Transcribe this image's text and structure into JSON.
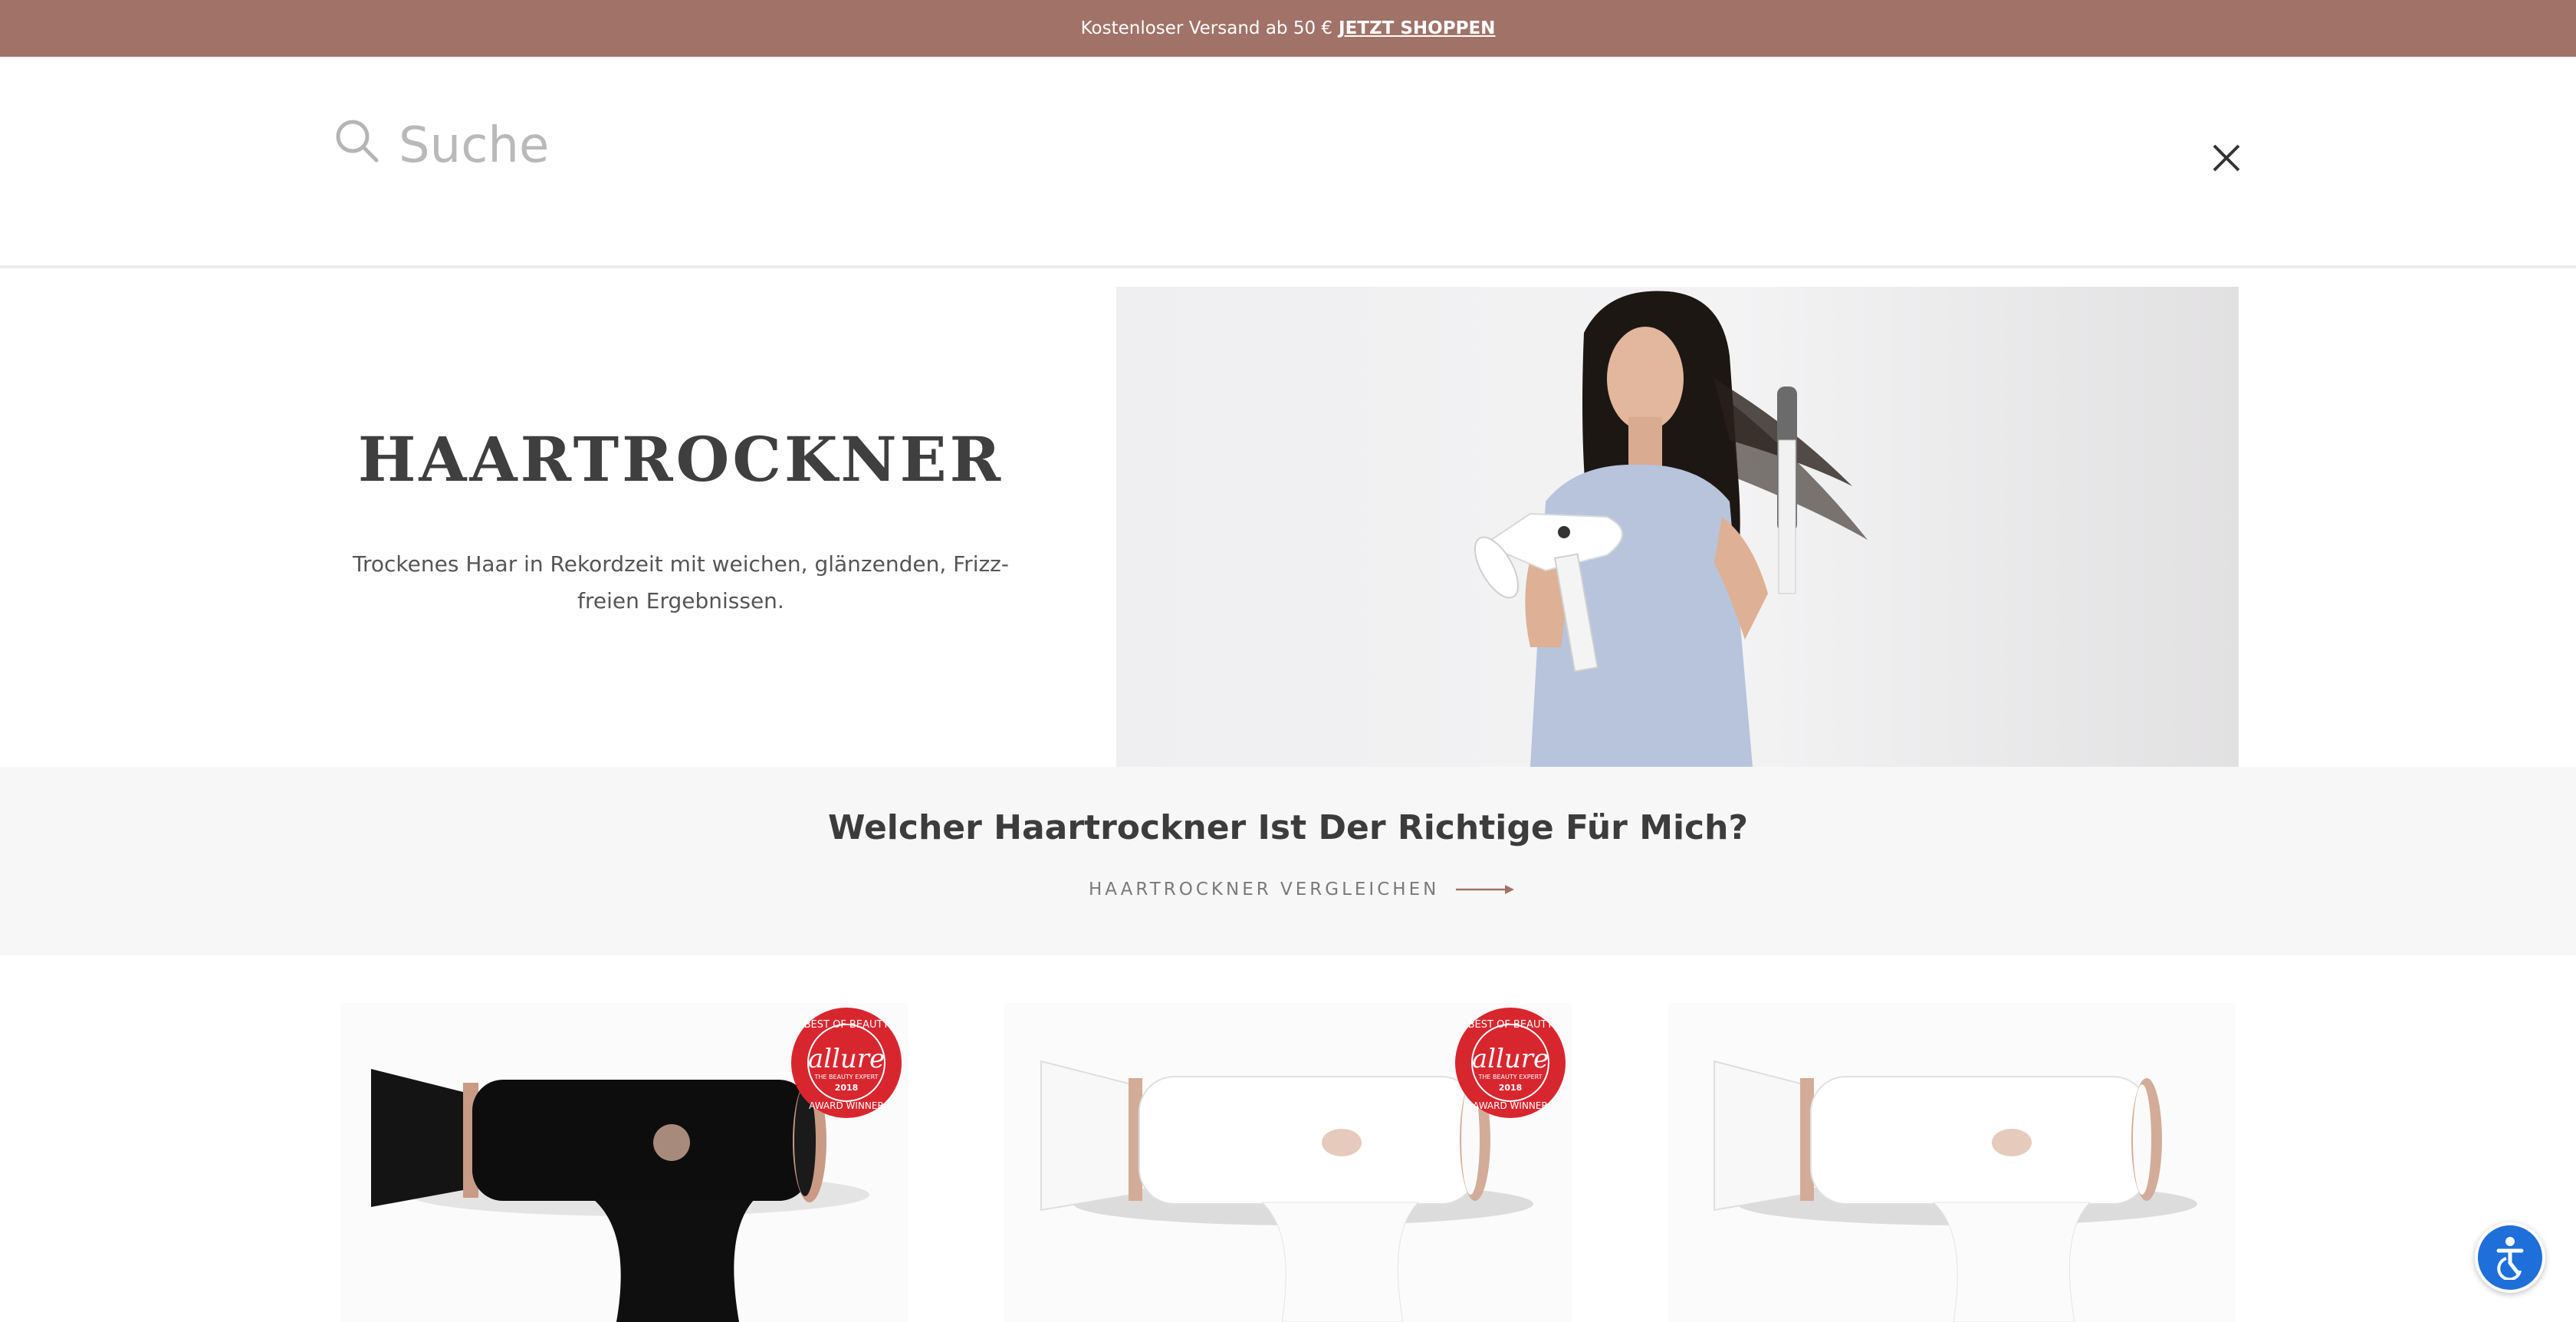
{
  "announcement": {
    "text": "Kostenloser Versand ab 50 €",
    "cta": "JETZT SHOPPEN"
  },
  "search": {
    "placeholder": "Suche",
    "value": ""
  },
  "hero": {
    "title": "HAARTROCKNER",
    "subtitle": "Trockenes Haar in Rekordzeit mit weichen, glänzenden, Frizz-freien Ergebnissen."
  },
  "compare": {
    "title": "Welcher Haartrockner Ist Der Richtige Für Mich?",
    "link_label": "HAARTROCKNER VERGLEICHEN"
  },
  "badge": {
    "arc_top": "BEST OF BEAUTY",
    "brand": "allure",
    "tagline": "THE BEAUTY EXPERT",
    "year": "2018",
    "arc_bottom": "AWARD WINNER"
  },
  "products": [
    {
      "color": "black",
      "award_badge": true
    },
    {
      "color": "white",
      "award_badge": true
    },
    {
      "color": "white",
      "award_badge": false
    }
  ],
  "colors": {
    "announcement_bg": "#a07268",
    "accent_arrow": "#a07268",
    "band_bg": "#f7f7f7",
    "badge_red": "#d8262f",
    "a11y_blue": "#1e6fd9"
  },
  "icons": {
    "search": "search-icon",
    "close": "close-icon",
    "arrow": "arrow-right-icon",
    "accessibility": "accessibility-icon"
  }
}
